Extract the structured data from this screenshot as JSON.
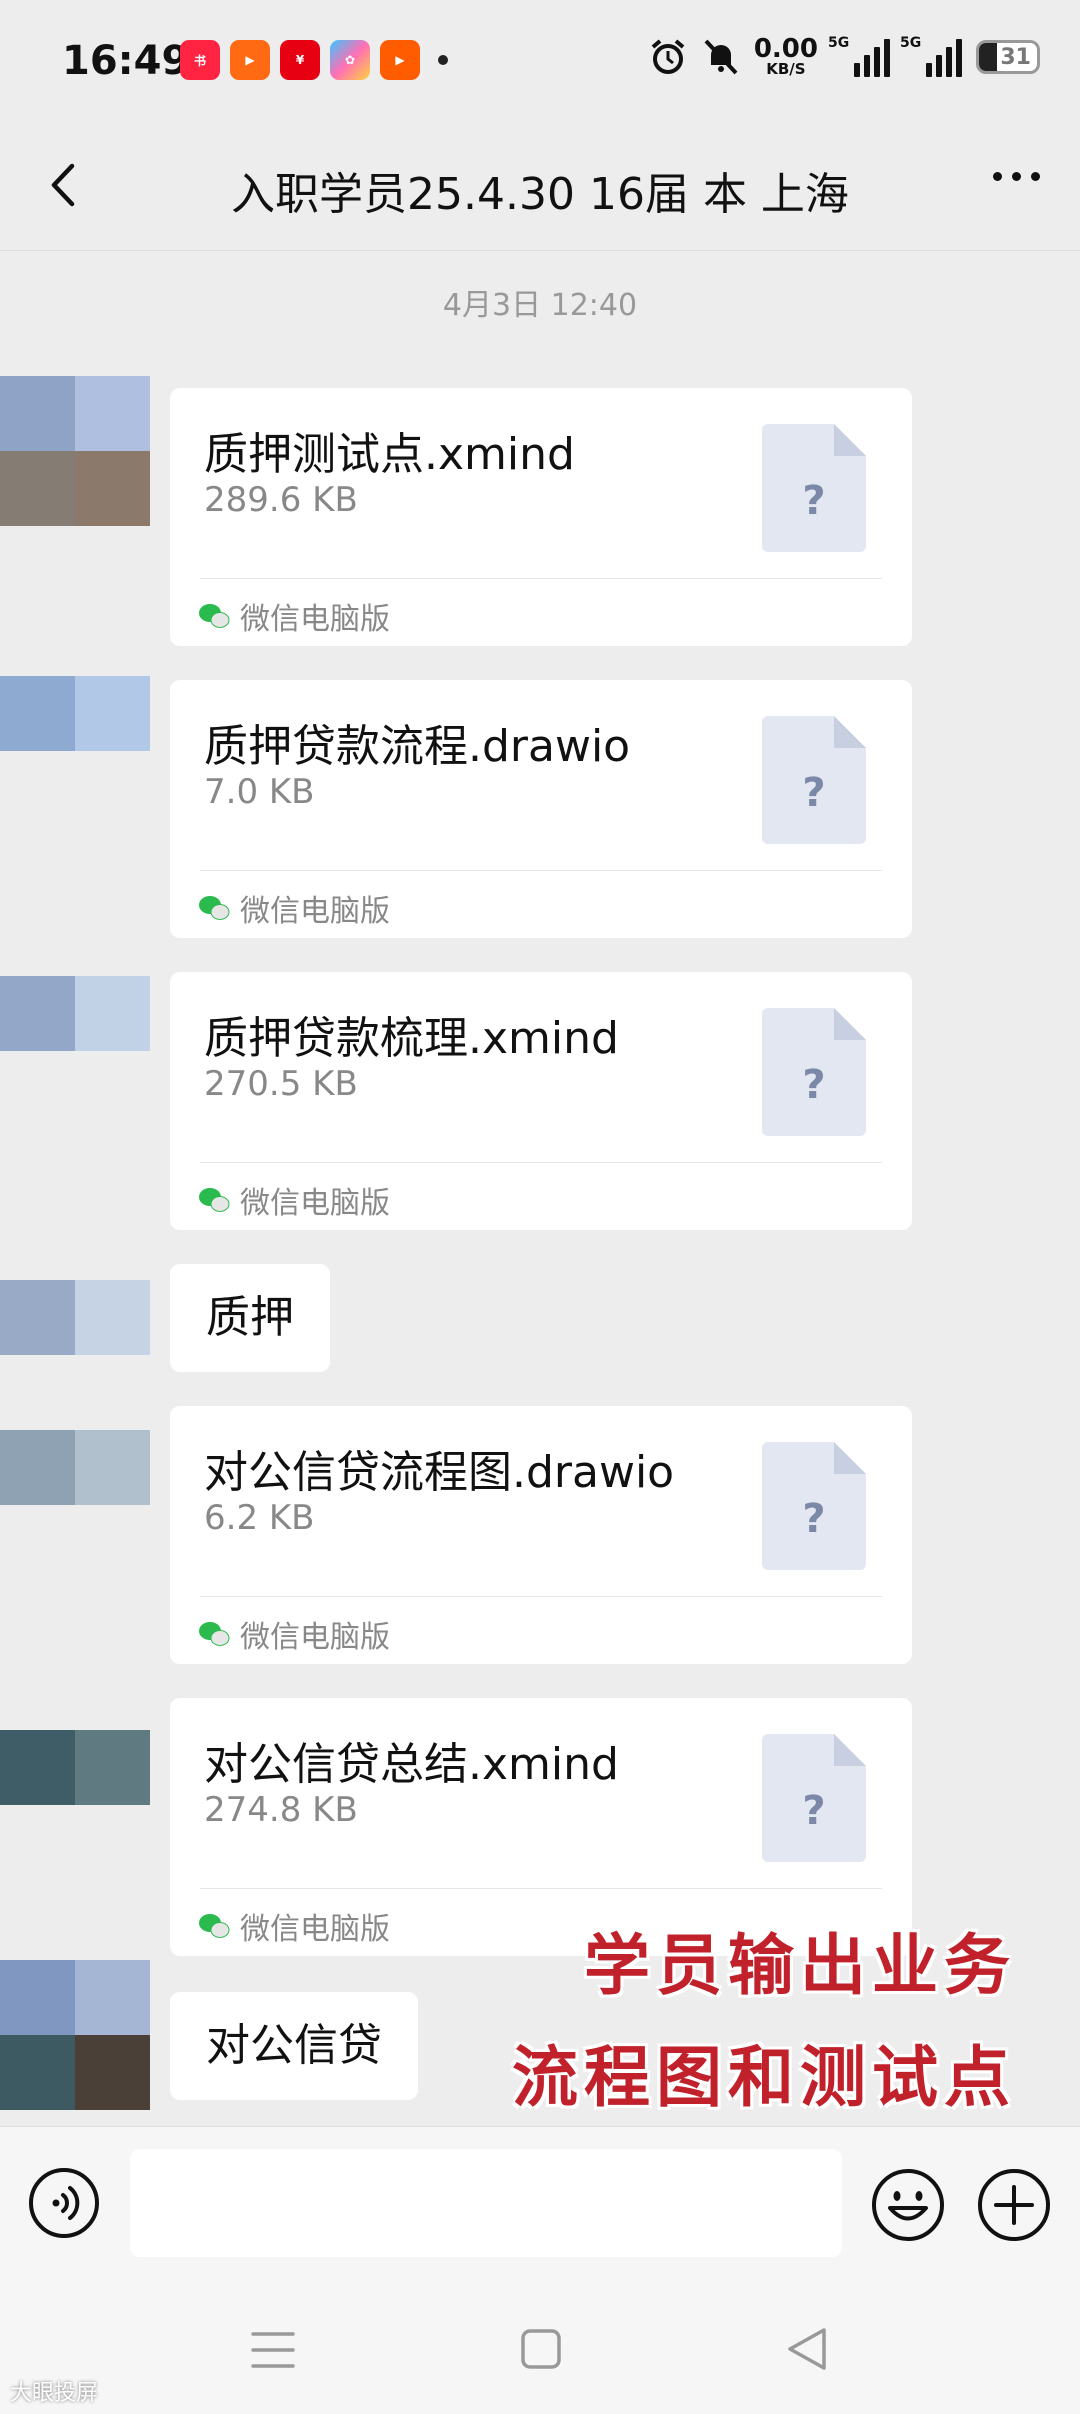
{
  "status_bar": {
    "time": "16:49",
    "net_speed_value": "0.00",
    "net_speed_unit": "KB/S",
    "signal1_label": "5G",
    "signal2_label": "5G",
    "battery_percent": "31",
    "app_icons": [
      "xiaohongshu-icon",
      "kuaishou-icon",
      "yunshanfu-icon",
      "app-store-icon",
      "kuaishou-lite-icon"
    ]
  },
  "header": {
    "title": "入职学员25.4.30 16届 本 上海"
  },
  "chat": {
    "timestamp": "4月3日 12:40",
    "messages": [
      {
        "type": "file",
        "name": "质押测试点.xmind",
        "size": "289.6 KB",
        "source": "微信电脑版"
      },
      {
        "type": "file",
        "name": "质押贷款流程.drawio",
        "size": "7.0 KB",
        "source": "微信电脑版"
      },
      {
        "type": "file",
        "name": "质押贷款梳理.xmind",
        "size": "270.5 KB",
        "source": "微信电脑版"
      },
      {
        "type": "text",
        "text": "质押"
      },
      {
        "type": "file",
        "name": "对公信贷流程图.drawio",
        "size": "6.2 KB",
        "source": "微信电脑版"
      },
      {
        "type": "file",
        "name": "对公信贷总结.xmind",
        "size": "274.8 KB",
        "source": "微信电脑版"
      },
      {
        "type": "text",
        "text": "对公信贷"
      }
    ]
  },
  "overlay": {
    "line1": "学员输出业务",
    "line2": "流程图和测试点"
  },
  "input_bar": {
    "value": "",
    "voice_icon": "voice-icon",
    "emoji_icon": "emoji-icon",
    "plus_icon": "plus-icon"
  },
  "watermark": "大眼投屏",
  "colors": {
    "background": "#ededed",
    "bubble": "#ffffff",
    "overlay_text": "#c0212a",
    "file_icon": "#e3e7f1"
  }
}
